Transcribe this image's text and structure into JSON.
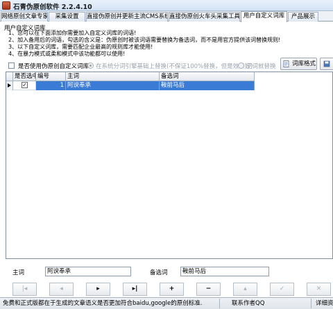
{
  "window": {
    "title": "石青伪原创软件 2.2.4.10"
  },
  "tabs": [
    {
      "label": "网络原创文章专家"
    },
    {
      "label": "采集设置"
    },
    {
      "label": "直接伪原创并更新主流CMS系统"
    },
    {
      "label": "直接伪原创火车头采集工具"
    },
    {
      "label": "用户自定义词库"
    },
    {
      "label": "产品展示"
    }
  ],
  "active_tab": "用户自定义词库",
  "section": {
    "title": "用户自定义词库",
    "notes": [
      "1、您可以在下面添加你需要加入自定义词库的词语!",
      "2、加入备用后的词语，勾选的含义是：伪原创时被该词语需要替换为备选词，而不是用官方提供该词替换规则!",
      "3、以下自定义词库，需要匹配企业最高的规则库才能使用!",
      "4、在暴力模式或柔和模式中该功能都可以使用!"
    ]
  },
  "options": {
    "use_custom_label": "是否使用伪原创自定义词库",
    "use_custom_checked": false,
    "radio_system_label": "在系统分词引擎基础上替换(不保证100%替换，但是效果好)",
    "radio_system_selected": true,
    "radio_direct_label": "见词就替换",
    "radio_direct_selected": false,
    "format_button": "词库格式"
  },
  "grid": {
    "columns": [
      "是否选中",
      "编号",
      "主词",
      "备选词"
    ],
    "rows": [
      {
        "selected": true,
        "id": "1",
        "main": "阿谀奉承",
        "alt": "鞍前马后"
      }
    ]
  },
  "detail": {
    "main_label": "主词",
    "main_value": "阿谀奉承",
    "alt_label": "备选词",
    "alt_value": "鞍前马后"
  },
  "navigator": {
    "buttons": [
      {
        "name": "first",
        "glyph": "|◂",
        "enabled": false
      },
      {
        "name": "prev",
        "glyph": "◂",
        "enabled": false
      },
      {
        "name": "next",
        "glyph": "▸",
        "enabled": true
      },
      {
        "name": "last",
        "glyph": "▸|",
        "enabled": true
      },
      {
        "name": "insert",
        "glyph": "+",
        "enabled": true
      },
      {
        "name": "delete",
        "glyph": "−",
        "enabled": true
      },
      {
        "name": "edit",
        "glyph": "▴",
        "enabled": false
      },
      {
        "name": "post",
        "glyph": "✓",
        "enabled": false
      },
      {
        "name": "cancel",
        "glyph": "✕",
        "enabled": false
      },
      {
        "name": "refresh",
        "glyph": "↻",
        "enabled": false
      }
    ]
  },
  "statusbar": {
    "message": "免费和正式版都在于生成的文章语义是否更加符合baidu,google的原创标准.",
    "contact": "联系作者QQ",
    "details": "详细资"
  },
  "icons": {
    "app": "app-logo-icon",
    "format": "document-icon"
  },
  "colors": {
    "selection": "#3a7bd5",
    "accent": "#d3e3f5"
  }
}
